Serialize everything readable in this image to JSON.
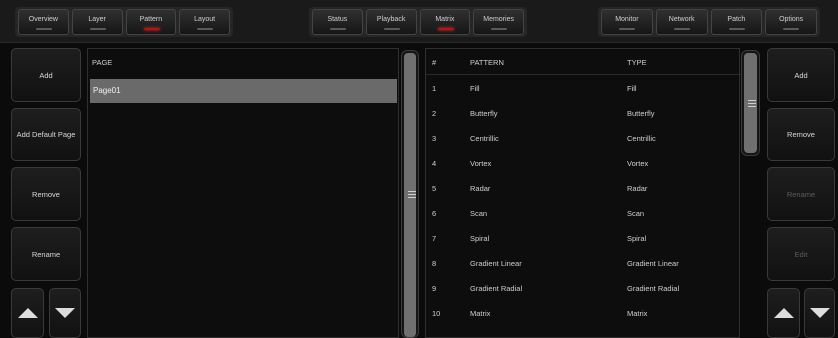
{
  "top_tabs": {
    "group1": [
      {
        "label": "Overview",
        "active": false
      },
      {
        "label": "Layer",
        "active": false
      },
      {
        "label": "Pattern",
        "active": true
      },
      {
        "label": "Layout",
        "active": false
      }
    ],
    "group2": [
      {
        "label": "Status",
        "active": false
      },
      {
        "label": "Playback",
        "active": false
      },
      {
        "label": "Matrix",
        "active": true
      },
      {
        "label": "Memories",
        "active": false
      }
    ],
    "group3": [
      {
        "label": "Monitor",
        "active": false
      },
      {
        "label": "Network",
        "active": false
      },
      {
        "label": "Patch",
        "active": false
      },
      {
        "label": "Options",
        "active": false
      }
    ]
  },
  "left_buttons": {
    "add": "Add",
    "add_default_page": "Add Default Page",
    "remove": "Remove",
    "rename": "Rename"
  },
  "page_panel": {
    "header": "PAGE",
    "items": [
      "Page01"
    ]
  },
  "pattern_table": {
    "headers": {
      "index": "#",
      "pattern": "PATTERN",
      "type": "TYPE"
    },
    "rows": [
      {
        "index": "1",
        "pattern": "Fill",
        "type": "Fill"
      },
      {
        "index": "2",
        "pattern": "Butterfly",
        "type": "Butterfly"
      },
      {
        "index": "3",
        "pattern": "Centrillic",
        "type": "Centrillic"
      },
      {
        "index": "4",
        "pattern": "Vortex",
        "type": "Vortex"
      },
      {
        "index": "5",
        "pattern": "Radar",
        "type": "Radar"
      },
      {
        "index": "6",
        "pattern": "Scan",
        "type": "Scan"
      },
      {
        "index": "7",
        "pattern": "Spiral",
        "type": "Spiral"
      },
      {
        "index": "8",
        "pattern": "Gradient Linear",
        "type": "Gradient Linear"
      },
      {
        "index": "9",
        "pattern": "Gradient Radial",
        "type": "Gradient Radial"
      },
      {
        "index": "10",
        "pattern": "Matrix",
        "type": "Matrix"
      }
    ]
  },
  "right_buttons": {
    "add": "Add",
    "remove": "Remove",
    "rename": "Rename",
    "edit": "Edit"
  },
  "colors": {
    "active_led": "#b21515",
    "selected_row": "#6a6a6a"
  },
  "icons": [
    "arrow-up-icon",
    "arrow-down-icon",
    "scroll-grip-icon"
  ]
}
